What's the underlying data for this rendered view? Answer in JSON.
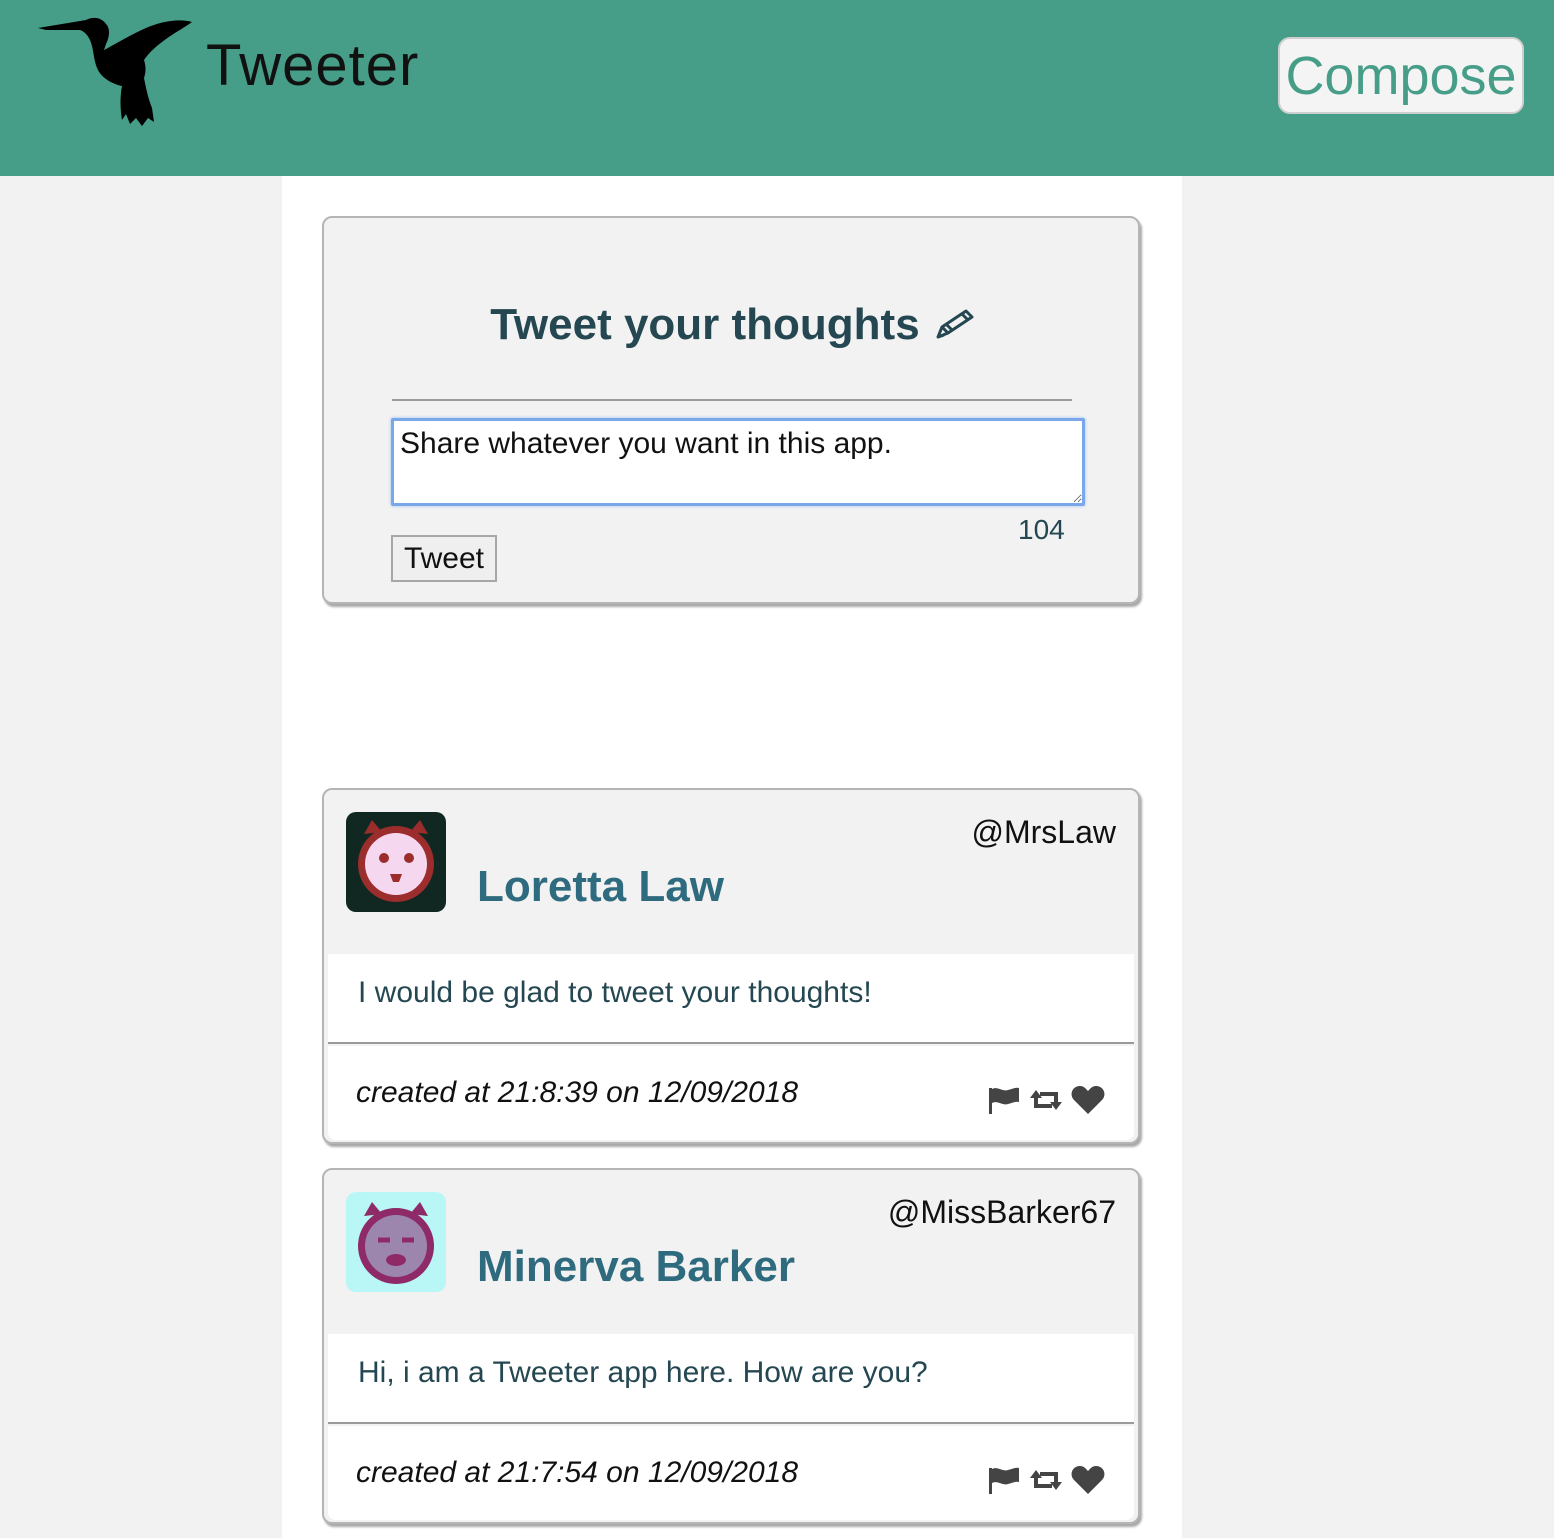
{
  "navbar": {
    "brand": "Tweeter",
    "compose_label": "Compose",
    "colors": {
      "background": "#479e88",
      "compose_text": "#479e88"
    }
  },
  "composer": {
    "title": "Tweet your thoughts",
    "title_icon": "pencil-icon",
    "input_value": "Share whatever you want in this app.",
    "counter": "104",
    "submit_label": "Tweet"
  },
  "tweets": [
    {
      "name": "Loretta Law",
      "handle": "@MrsLaw",
      "avatar_icon": "devil-face-avatar",
      "avatar_colors": {
        "bg": "#112722",
        "ring": "#9b2d2d",
        "face": "#f6d7f0"
      },
      "text": "I would be glad to tweet your thoughts!",
      "timestamp": "created at 21:8:39 on 12/09/2018",
      "actions": [
        "flag-icon",
        "retweet-icon",
        "heart-icon"
      ]
    },
    {
      "name": "Minerva Barker",
      "handle": "@MissBarker67",
      "avatar_icon": "devil-face-avatar",
      "avatar_colors": {
        "bg": "#b9f7f7",
        "ring": "#8e2a67",
        "face": "#9d86ae"
      },
      "text": "Hi, i am a Tweeter app here. How are you?",
      "timestamp": "created at 21:7:54 on 12/09/2018",
      "actions": [
        "flag-icon",
        "retweet-icon",
        "heart-icon"
      ]
    }
  ]
}
